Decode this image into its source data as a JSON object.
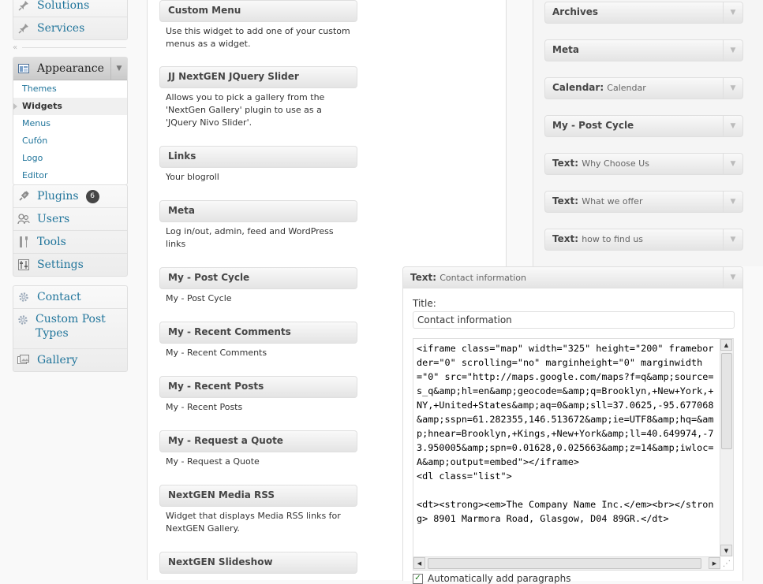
{
  "admin_menu": {
    "top_group": [
      {
        "label": "Solutions",
        "icon": "pin-icon"
      },
      {
        "label": "Services",
        "icon": "pin-icon"
      }
    ],
    "appearance": {
      "label": "Appearance",
      "icon": "appearance-icon",
      "submenu": [
        "Themes",
        "Widgets",
        "Menus",
        "Cufón",
        "Logo",
        "Editor"
      ],
      "current": "Widgets"
    },
    "mid_group": [
      {
        "label": "Plugins",
        "icon": "plugins-icon",
        "badge": "6"
      },
      {
        "label": "Users",
        "icon": "users-icon"
      },
      {
        "label": "Tools",
        "icon": "tools-icon"
      },
      {
        "label": "Settings",
        "icon": "settings-icon"
      }
    ],
    "bottom_group": [
      {
        "label": "Contact",
        "icon": "gear-icon"
      },
      {
        "label": "Custom Post Types",
        "icon": "gear-icon"
      },
      {
        "label": "Gallery",
        "icon": "gallery-icon"
      }
    ]
  },
  "available_widgets": [
    {
      "title": "Custom Menu",
      "desc": "Use this widget to add one of your custom menus as a widget."
    },
    {
      "title": "JJ NextGEN JQuery Slider",
      "desc": "Allows you to pick a gallery from the 'NextGen Gallery' plugin to use as a 'JQuery Nivo Slider'."
    },
    {
      "title": "Links",
      "desc": "Your blogroll"
    },
    {
      "title": "Meta",
      "desc": "Log in/out, admin, feed and WordPress links"
    },
    {
      "title": "My - Post Cycle",
      "desc": "My - Post Cycle"
    },
    {
      "title": "My - Recent Comments",
      "desc": "My - Recent Comments"
    },
    {
      "title": "My - Recent Posts",
      "desc": "My - Recent Posts"
    },
    {
      "title": "My - Request a Quote",
      "desc": "My - Request a Quote"
    },
    {
      "title": "NextGEN Media RSS",
      "desc": "Widget that displays Media RSS links for NextGEN Gallery."
    },
    {
      "title": "NextGEN Slideshow",
      "desc": ""
    }
  ],
  "sidebar_widgets": [
    {
      "title": "Archives",
      "instance": ""
    },
    {
      "title": "Meta",
      "instance": ""
    },
    {
      "title": "Calendar",
      "instance": "Calendar"
    },
    {
      "title": "My - Post Cycle",
      "instance": ""
    },
    {
      "title": "Text",
      "instance": "Why Choose Us"
    },
    {
      "title": "Text",
      "instance": "What we offer"
    },
    {
      "title": "Text",
      "instance": "how to find us"
    }
  ],
  "open_widget": {
    "title": "Text",
    "instance": "Contact information",
    "title_label": "Title:",
    "title_value": "Contact information",
    "content": "<iframe class=\"map\" width=\"325\" height=\"200\" frameborder=\"0\" scrolling=\"no\" marginheight=\"0\" marginwidth=\"0\" src=\"http://maps.google.com/maps?f=q&amp;source=s_q&amp;hl=en&amp;geocode=&amp;q=Brooklyn,+New+York,+NY,+United+States&amp;aq=0&amp;sll=37.0625,-95.677068&amp;sspn=61.282355,146.513672&amp;ie=UTF8&amp;hq=&amp;hnear=Brooklyn,+Kings,+New+York&amp;ll=40.649974,-73.950005&amp;spn=0.01628,0.025663&amp;z=14&amp;iwloc=A&amp;output=embed\"></iframe>\n<dl class=\"list\">\n\n<dt><strong><em>The Company Name Inc.</em><br></strong> 8901 Marmora Road, Glasgow, D04 89GR.</dt>",
    "autop_label": "Automatically add paragraphs",
    "autop_checked": true
  }
}
